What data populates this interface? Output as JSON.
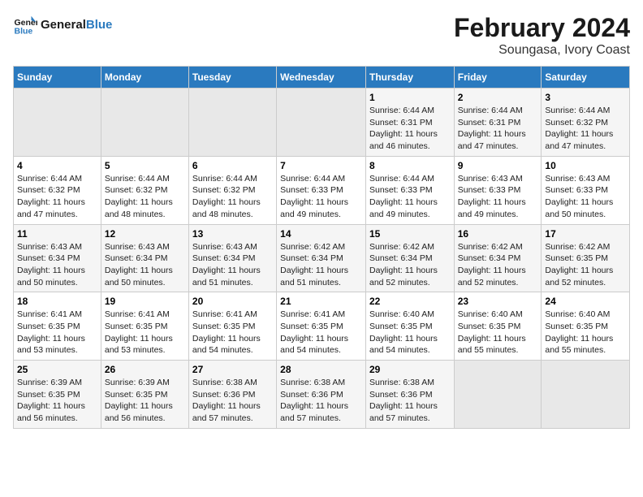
{
  "logo": {
    "text_general": "General",
    "text_blue": "Blue"
  },
  "title": "February 2024",
  "subtitle": "Soungasa, Ivory Coast",
  "days_of_week": [
    "Sunday",
    "Monday",
    "Tuesday",
    "Wednesday",
    "Thursday",
    "Friday",
    "Saturday"
  ],
  "weeks": [
    [
      {
        "day": "",
        "sunrise": "",
        "sunset": "",
        "daylight": ""
      },
      {
        "day": "",
        "sunrise": "",
        "sunset": "",
        "daylight": ""
      },
      {
        "day": "",
        "sunrise": "",
        "sunset": "",
        "daylight": ""
      },
      {
        "day": "",
        "sunrise": "",
        "sunset": "",
        "daylight": ""
      },
      {
        "day": "1",
        "sunrise": "Sunrise: 6:44 AM",
        "sunset": "Sunset: 6:31 PM",
        "daylight": "Daylight: 11 hours and 46 minutes."
      },
      {
        "day": "2",
        "sunrise": "Sunrise: 6:44 AM",
        "sunset": "Sunset: 6:31 PM",
        "daylight": "Daylight: 11 hours and 47 minutes."
      },
      {
        "day": "3",
        "sunrise": "Sunrise: 6:44 AM",
        "sunset": "Sunset: 6:32 PM",
        "daylight": "Daylight: 11 hours and 47 minutes."
      }
    ],
    [
      {
        "day": "4",
        "sunrise": "Sunrise: 6:44 AM",
        "sunset": "Sunset: 6:32 PM",
        "daylight": "Daylight: 11 hours and 47 minutes."
      },
      {
        "day": "5",
        "sunrise": "Sunrise: 6:44 AM",
        "sunset": "Sunset: 6:32 PM",
        "daylight": "Daylight: 11 hours and 48 minutes."
      },
      {
        "day": "6",
        "sunrise": "Sunrise: 6:44 AM",
        "sunset": "Sunset: 6:32 PM",
        "daylight": "Daylight: 11 hours and 48 minutes."
      },
      {
        "day": "7",
        "sunrise": "Sunrise: 6:44 AM",
        "sunset": "Sunset: 6:33 PM",
        "daylight": "Daylight: 11 hours and 49 minutes."
      },
      {
        "day": "8",
        "sunrise": "Sunrise: 6:44 AM",
        "sunset": "Sunset: 6:33 PM",
        "daylight": "Daylight: 11 hours and 49 minutes."
      },
      {
        "day": "9",
        "sunrise": "Sunrise: 6:43 AM",
        "sunset": "Sunset: 6:33 PM",
        "daylight": "Daylight: 11 hours and 49 minutes."
      },
      {
        "day": "10",
        "sunrise": "Sunrise: 6:43 AM",
        "sunset": "Sunset: 6:33 PM",
        "daylight": "Daylight: 11 hours and 50 minutes."
      }
    ],
    [
      {
        "day": "11",
        "sunrise": "Sunrise: 6:43 AM",
        "sunset": "Sunset: 6:34 PM",
        "daylight": "Daylight: 11 hours and 50 minutes."
      },
      {
        "day": "12",
        "sunrise": "Sunrise: 6:43 AM",
        "sunset": "Sunset: 6:34 PM",
        "daylight": "Daylight: 11 hours and 50 minutes."
      },
      {
        "day": "13",
        "sunrise": "Sunrise: 6:43 AM",
        "sunset": "Sunset: 6:34 PM",
        "daylight": "Daylight: 11 hours and 51 minutes."
      },
      {
        "day": "14",
        "sunrise": "Sunrise: 6:42 AM",
        "sunset": "Sunset: 6:34 PM",
        "daylight": "Daylight: 11 hours and 51 minutes."
      },
      {
        "day": "15",
        "sunrise": "Sunrise: 6:42 AM",
        "sunset": "Sunset: 6:34 PM",
        "daylight": "Daylight: 11 hours and 52 minutes."
      },
      {
        "day": "16",
        "sunrise": "Sunrise: 6:42 AM",
        "sunset": "Sunset: 6:34 PM",
        "daylight": "Daylight: 11 hours and 52 minutes."
      },
      {
        "day": "17",
        "sunrise": "Sunrise: 6:42 AM",
        "sunset": "Sunset: 6:35 PM",
        "daylight": "Daylight: 11 hours and 52 minutes."
      }
    ],
    [
      {
        "day": "18",
        "sunrise": "Sunrise: 6:41 AM",
        "sunset": "Sunset: 6:35 PM",
        "daylight": "Daylight: 11 hours and 53 minutes."
      },
      {
        "day": "19",
        "sunrise": "Sunrise: 6:41 AM",
        "sunset": "Sunset: 6:35 PM",
        "daylight": "Daylight: 11 hours and 53 minutes."
      },
      {
        "day": "20",
        "sunrise": "Sunrise: 6:41 AM",
        "sunset": "Sunset: 6:35 PM",
        "daylight": "Daylight: 11 hours and 54 minutes."
      },
      {
        "day": "21",
        "sunrise": "Sunrise: 6:41 AM",
        "sunset": "Sunset: 6:35 PM",
        "daylight": "Daylight: 11 hours and 54 minutes."
      },
      {
        "day": "22",
        "sunrise": "Sunrise: 6:40 AM",
        "sunset": "Sunset: 6:35 PM",
        "daylight": "Daylight: 11 hours and 54 minutes."
      },
      {
        "day": "23",
        "sunrise": "Sunrise: 6:40 AM",
        "sunset": "Sunset: 6:35 PM",
        "daylight": "Daylight: 11 hours and 55 minutes."
      },
      {
        "day": "24",
        "sunrise": "Sunrise: 6:40 AM",
        "sunset": "Sunset: 6:35 PM",
        "daylight": "Daylight: 11 hours and 55 minutes."
      }
    ],
    [
      {
        "day": "25",
        "sunrise": "Sunrise: 6:39 AM",
        "sunset": "Sunset: 6:35 PM",
        "daylight": "Daylight: 11 hours and 56 minutes."
      },
      {
        "day": "26",
        "sunrise": "Sunrise: 6:39 AM",
        "sunset": "Sunset: 6:35 PM",
        "daylight": "Daylight: 11 hours and 56 minutes."
      },
      {
        "day": "27",
        "sunrise": "Sunrise: 6:38 AM",
        "sunset": "Sunset: 6:36 PM",
        "daylight": "Daylight: 11 hours and 57 minutes."
      },
      {
        "day": "28",
        "sunrise": "Sunrise: 6:38 AM",
        "sunset": "Sunset: 6:36 PM",
        "daylight": "Daylight: 11 hours and 57 minutes."
      },
      {
        "day": "29",
        "sunrise": "Sunrise: 6:38 AM",
        "sunset": "Sunset: 6:36 PM",
        "daylight": "Daylight: 11 hours and 57 minutes."
      },
      {
        "day": "",
        "sunrise": "",
        "sunset": "",
        "daylight": ""
      },
      {
        "day": "",
        "sunrise": "",
        "sunset": "",
        "daylight": ""
      }
    ]
  ]
}
